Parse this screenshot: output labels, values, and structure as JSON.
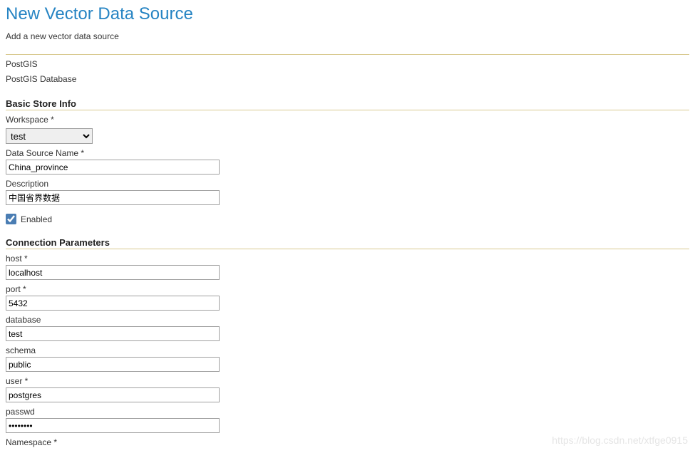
{
  "header": {
    "title": "New Vector Data Source",
    "subtitle": "Add a new vector data source"
  },
  "store_type": {
    "line1": "PostGIS",
    "line2": "PostGIS Database"
  },
  "sections": {
    "basic": "Basic Store Info",
    "connection": "Connection Parameters"
  },
  "basic": {
    "workspace_label": "Workspace *",
    "workspace_value": "test",
    "data_source_name_label": "Data Source Name *",
    "data_source_name_value": "China_province",
    "description_label": "Description",
    "description_value": "中国省界数据",
    "enabled_label": "Enabled",
    "enabled_checked": true
  },
  "connection": {
    "host_label": "host *",
    "host_value": "localhost",
    "port_label": "port *",
    "port_value": "5432",
    "database_label": "database",
    "database_value": "test",
    "schema_label": "schema",
    "schema_value": "public",
    "user_label": "user *",
    "user_value": "postgres",
    "passwd_label": "passwd",
    "passwd_value": "••••••••",
    "namespace_label": "Namespace *"
  },
  "watermark": "https://blog.csdn.net/xtfge0915"
}
